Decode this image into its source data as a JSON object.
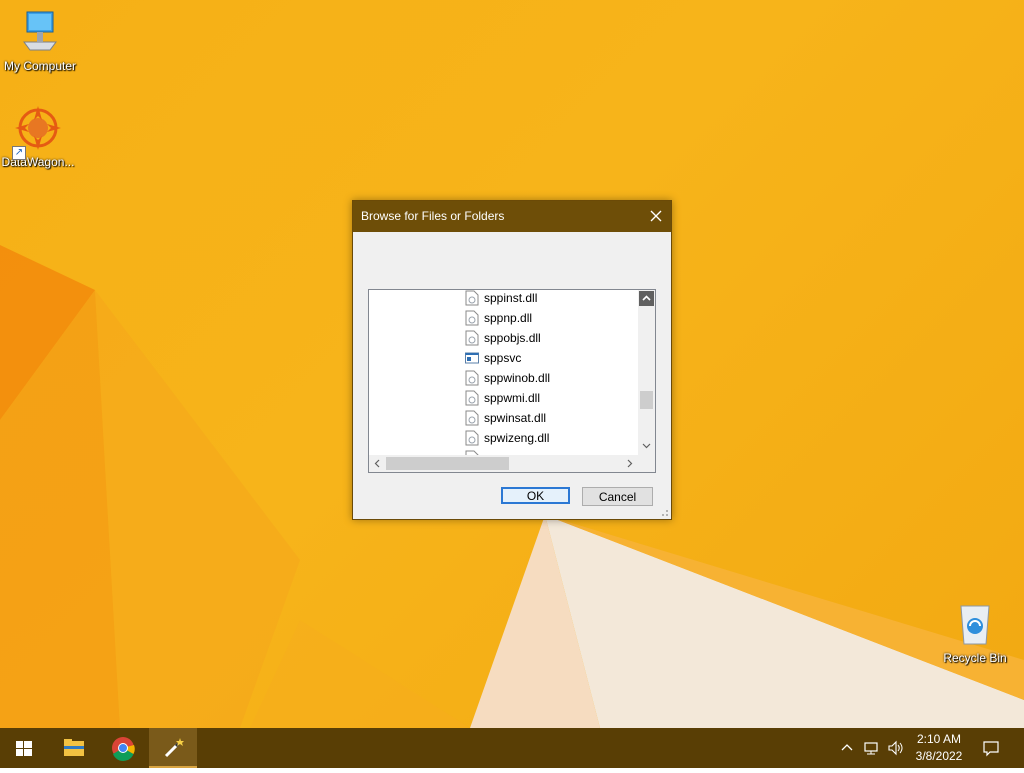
{
  "desktop": {
    "icons": [
      {
        "label": "My Computer",
        "icon": "computer-icon"
      },
      {
        "label": "DataWagon...",
        "icon": "datawagon-icon"
      },
      {
        "label": "Recycle Bin",
        "icon": "recycle-bin-icon"
      }
    ]
  },
  "dialog": {
    "title": "Browse for Files or Folders",
    "close_icon": "close-icon",
    "instruction": "",
    "tree_items": [
      {
        "label": "sppinst.dll",
        "icon": "dll-file-icon"
      },
      {
        "label": "sppnp.dll",
        "icon": "dll-file-icon"
      },
      {
        "label": "sppobjs.dll",
        "icon": "dll-file-icon"
      },
      {
        "label": "sppsvc",
        "icon": "executable-icon"
      },
      {
        "label": "sppwinob.dll",
        "icon": "dll-file-icon"
      },
      {
        "label": "sppwmi.dll",
        "icon": "dll-file-icon"
      },
      {
        "label": "spwinsat.dll",
        "icon": "dll-file-icon"
      },
      {
        "label": "spwizeng.dll",
        "icon": "dll-file-icon"
      }
    ],
    "ok_label": "OK",
    "cancel_label": "Cancel"
  },
  "taskbar": {
    "items": [
      {
        "name": "start-button",
        "icon": "windows-logo-icon"
      },
      {
        "name": "file-explorer-button",
        "icon": "folder-icon"
      },
      {
        "name": "chrome-button",
        "icon": "chrome-icon"
      },
      {
        "name": "app-button",
        "icon": "magic-wand-icon",
        "active": true
      }
    ],
    "tray": {
      "icons": [
        "chevron-up-icon",
        "network-icon",
        "volume-icon"
      ],
      "time": "2:10 AM",
      "date": "3/8/2022",
      "notification_icon": "notification-icon"
    }
  },
  "colors": {
    "taskbar": "#593e05",
    "titlebar": "#6e4e08",
    "desktop": "#f6b016",
    "ok_border": "#2b78d4"
  }
}
